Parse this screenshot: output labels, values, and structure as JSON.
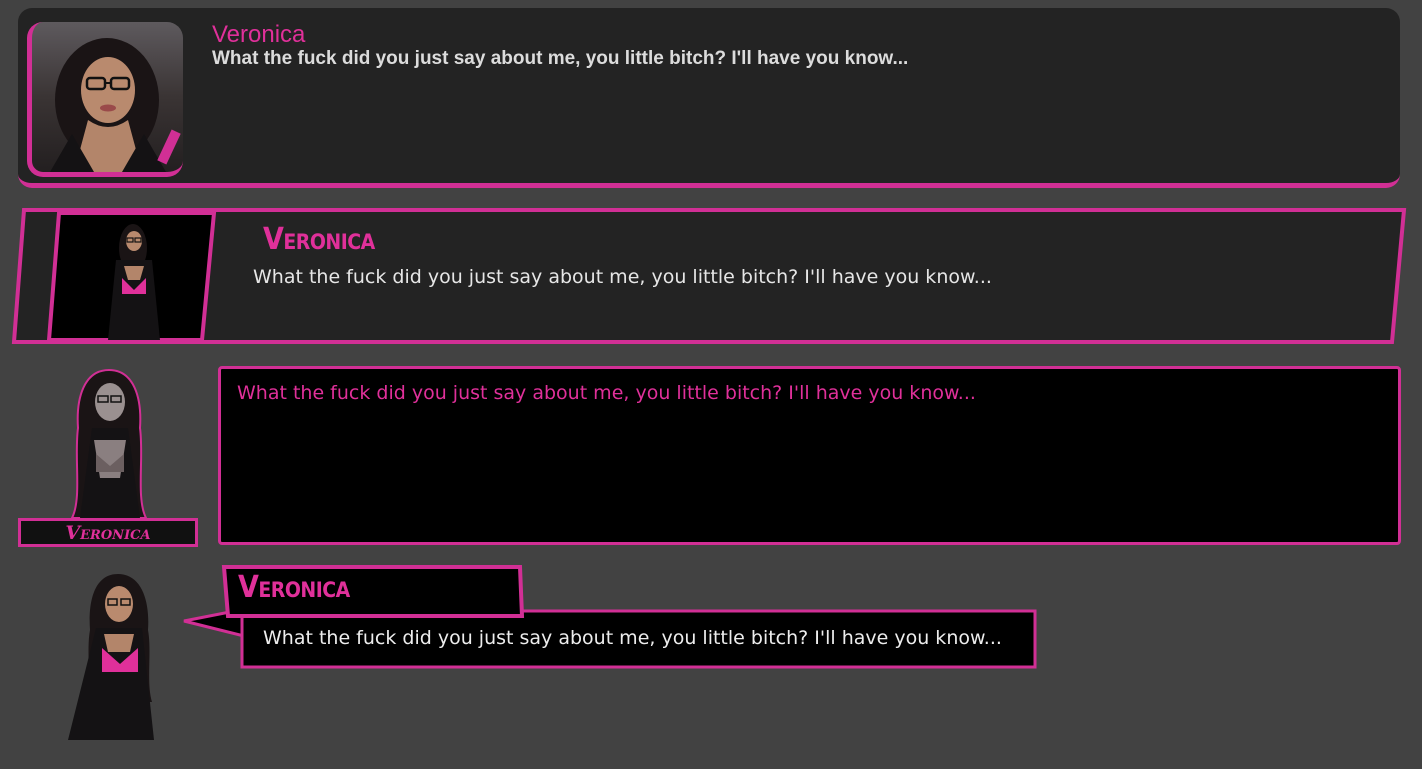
{
  "colors": {
    "background": "#424242",
    "panel": "#232323",
    "accent": "#d12f95",
    "accent_text": "#e0309a",
    "text_light": "#dcdcdc"
  },
  "styles": [
    {
      "id": "rounded-box",
      "name": "Veronica",
      "text": "What the fuck did you just say about me, you little bitch? I'll have you know...",
      "portrait_icon": "woman-portrait-icon"
    },
    {
      "id": "slanted-box",
      "name": "Veronica",
      "text": "What the fuck did you just say about me, you little bitch? I'll have you know...",
      "portrait_icon": "woman-figure-icon"
    },
    {
      "id": "plate-box",
      "name": "Veronica",
      "text": "What the fuck did you just say about me, you little bitch? I'll have you know...",
      "portrait_icon": "woman-figure-icon"
    },
    {
      "id": "speech-box",
      "name": "Veronica",
      "text": "What the fuck did you just say about me, you little bitch? I'll have you know...",
      "portrait_icon": "woman-figure-icon"
    }
  ]
}
